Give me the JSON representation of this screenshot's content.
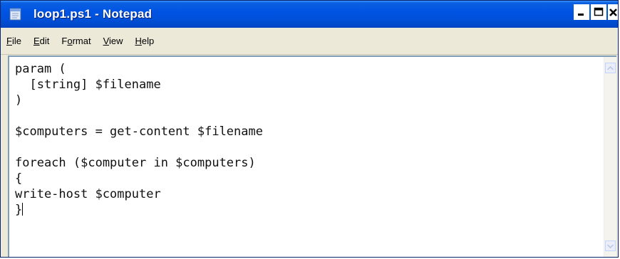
{
  "window": {
    "title": "loop1.ps1 - Notepad",
    "title_color": "#0054e3"
  },
  "menu": {
    "items": [
      {
        "label_u": "F",
        "label_rest": "ile"
      },
      {
        "label_u": "E",
        "label_rest": "dit"
      },
      {
        "label_pre": "F",
        "label_u": "o",
        "label_rest": "rmat"
      },
      {
        "label_u": "V",
        "label_rest": "iew"
      },
      {
        "label_u": "H",
        "label_rest": "elp"
      }
    ]
  },
  "editor": {
    "lines": [
      "param (",
      "  [string] $filename",
      ")",
      "",
      "$computers = get-content $filename",
      "",
      "foreach ($computer in $computers)",
      "{",
      "write-host $computer",
      "}"
    ]
  }
}
